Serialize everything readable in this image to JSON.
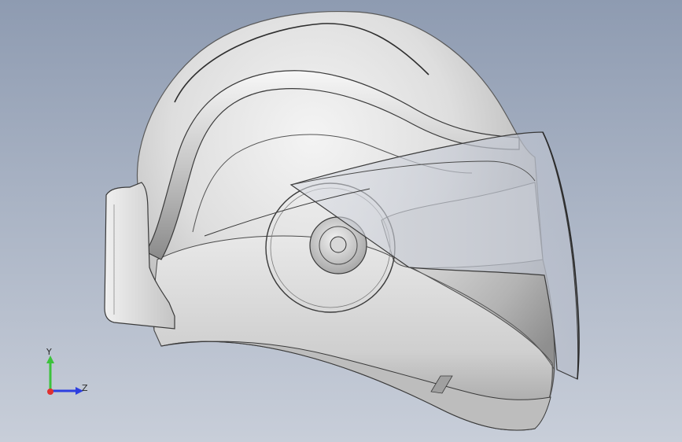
{
  "viewport": {
    "background_top": "#8e9bb1",
    "background_bottom": "#c8ced9"
  },
  "model": {
    "name": "helmet-model",
    "shell_color": "#e6e6e6",
    "shade_color": "#9c9c9c",
    "visor_color": "#c9cdd6",
    "edge_color": "#3a3a3a"
  },
  "triad": {
    "y_label": "Y",
    "z_label": "Z",
    "y_color": "#3cc23c",
    "z_color": "#2d3fe0",
    "x_color": "#e03030"
  }
}
